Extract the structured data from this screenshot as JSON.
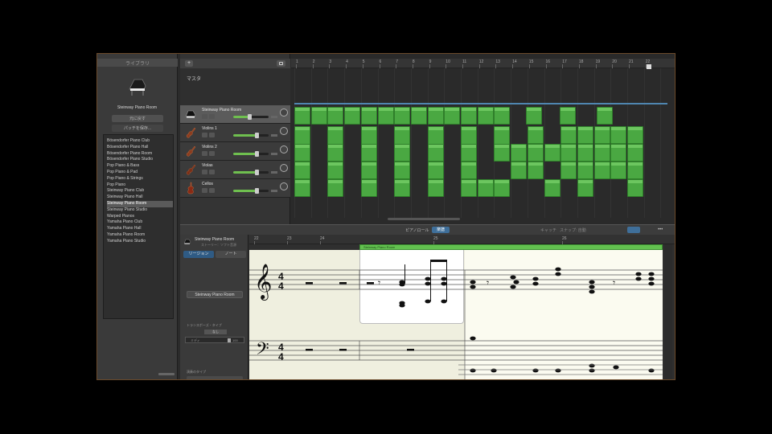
{
  "library": {
    "header": "ライブラリ",
    "instrument_name": "Steinway Piano Room",
    "button_restore": "元に戻す",
    "button_save": "パッチを保存...",
    "items": [
      "Bösendorfer Piano Club",
      "Bösendorfer Piano Hall",
      "Bösendorfer Piano Room",
      "Bösendorfer Piano Studio",
      "Pop Piano & Bass",
      "Pop Piano & Pad",
      "Pop Piano & Strings",
      "Pop Piano",
      "Steinway Piano Club",
      "Steinway Piano Hall",
      "Steinway Piano Room",
      "Steinway Piano Studio",
      "Warped Pianos",
      "Yamaha Piano Club",
      "Yamaha Piano Hall",
      "Yamaha Piano Room",
      "Yamaha Piano Studio"
    ],
    "selected_index": 10
  },
  "tracks": {
    "add_button": "+",
    "master_label": "マスタ",
    "list": [
      {
        "name": "Steinway Piano Room",
        "volume": 0.45,
        "selected": true,
        "icon": "piano-icon"
      },
      {
        "name": "Violins 1",
        "volume": 0.65,
        "selected": false,
        "icon": "violin-icon"
      },
      {
        "name": "Violins 2",
        "volume": 0.65,
        "selected": false,
        "icon": "violin-icon"
      },
      {
        "name": "Violas",
        "volume": 0.65,
        "selected": false,
        "icon": "viola-icon"
      },
      {
        "name": "Cellos",
        "volume": 0.65,
        "selected": false,
        "icon": "cello-icon"
      }
    ]
  },
  "arrange": {
    "ruler_bars": [
      "1",
      "2",
      "3",
      "4",
      "5",
      "6",
      "7",
      "8",
      "9",
      "10",
      "11",
      "12",
      "13",
      "14",
      "15",
      "16",
      "17",
      "18",
      "19",
      "20",
      "21",
      "22"
    ]
  },
  "editor": {
    "tab_piano_roll": "ピアノロール",
    "tab_score": "楽譜",
    "catch": "キャッチ",
    "snap": "スナップ: 自動",
    "more": "•••",
    "inspector": {
      "name": "Steinway Piano Room",
      "sub": "ストーリー：ソフト音源",
      "tab_region": "リージョン",
      "tab_note": "ノート",
      "region_name": "Steinway Piano Room",
      "transpose_label": "トランスポーズ・タイプ",
      "transpose_value": "なし",
      "range_left": "ミディ",
      "range_right": "100",
      "perf_label": "演奏のタイプ"
    },
    "ruler_bars": [
      {
        "label": "22"
      },
      {
        "label": "23"
      },
      {
        "label": "24"
      },
      {
        "label": "25"
      },
      {
        "label": "26"
      }
    ],
    "region_label": "Steinway Piano Room"
  }
}
